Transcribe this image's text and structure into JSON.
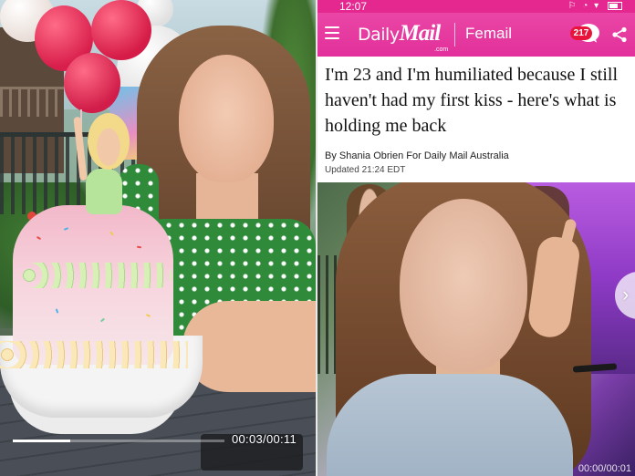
{
  "left_video": {
    "elapsed": "00:03",
    "duration": "00:11",
    "time_display": "00:03/00:11",
    "progress_fraction": 0.27
  },
  "phone": {
    "status_bar": {
      "time": "12:07",
      "icons": "⚐ ◔ ▾"
    },
    "header": {
      "logo_daily": "Daily",
      "logo_mail": "Mail",
      "logo_com": ".com",
      "section": "Femail",
      "comment_count": "217",
      "accent_color": "#e73ba0"
    },
    "article": {
      "headline": "I'm 23 and I'm humiliated because I still haven't had my first kiss - here's what is holding me back",
      "byline": "By Shania Obrien For Daily Mail Australia",
      "updated": "Updated 21:24 EDT"
    },
    "embed_video": {
      "time": "00:00/00:01"
    }
  }
}
